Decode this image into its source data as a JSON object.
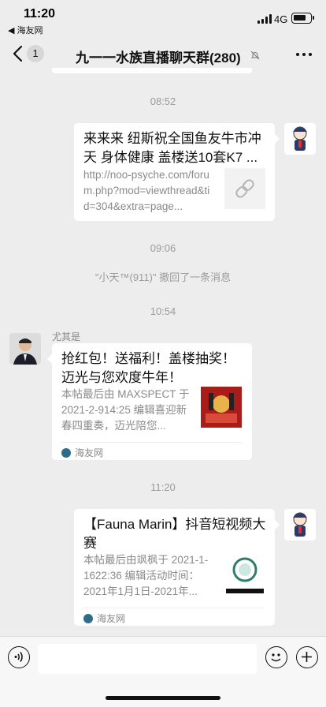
{
  "status": {
    "time": "11:20",
    "back_app": "◀ 海友网",
    "network": "4G",
    "battery_level": 0.78
  },
  "nav": {
    "unread": "1",
    "title": "九一一水族直播聊天群(280)"
  },
  "messages": {
    "ts1": "08:52",
    "card1": {
      "title": "来来来 纽斯祝全国鱼友牛市冲天 身体健康 盖楼送10套K7 ...",
      "desc": "http://noo-psyche.com/forum.php?mod=viewthread&tid=304&extra=page..."
    },
    "ts2": "09:06",
    "recall": "\"小天™(911)\" 撤回了一条消息",
    "ts3": "10:54",
    "sender2": "尤其是",
    "card2": {
      "title": "抢红包！送福利！盖楼抽奖！迈光与您欢度牛年！",
      "desc": "本帖最后由 MAXSPECT 于 2021-2-914:25 编辑喜迎新春四重奏，迈光陪您...",
      "source": "海友网"
    },
    "ts4": "11:20",
    "card3": {
      "title": "【Fauna Marin】抖音短视频大赛",
      "desc": "本帖最后由飒枫于 2021-1-1622:36 编辑活动时间：2021年1月1日-2021年...",
      "source": "海友网"
    }
  },
  "icons": {
    "back": "chevron-left-icon",
    "mute": "mute-bell-icon",
    "more": "more-dots-icon",
    "link": "link-icon",
    "voice": "voice-icon",
    "emoji": "emoji-icon",
    "plus": "plus-icon"
  }
}
